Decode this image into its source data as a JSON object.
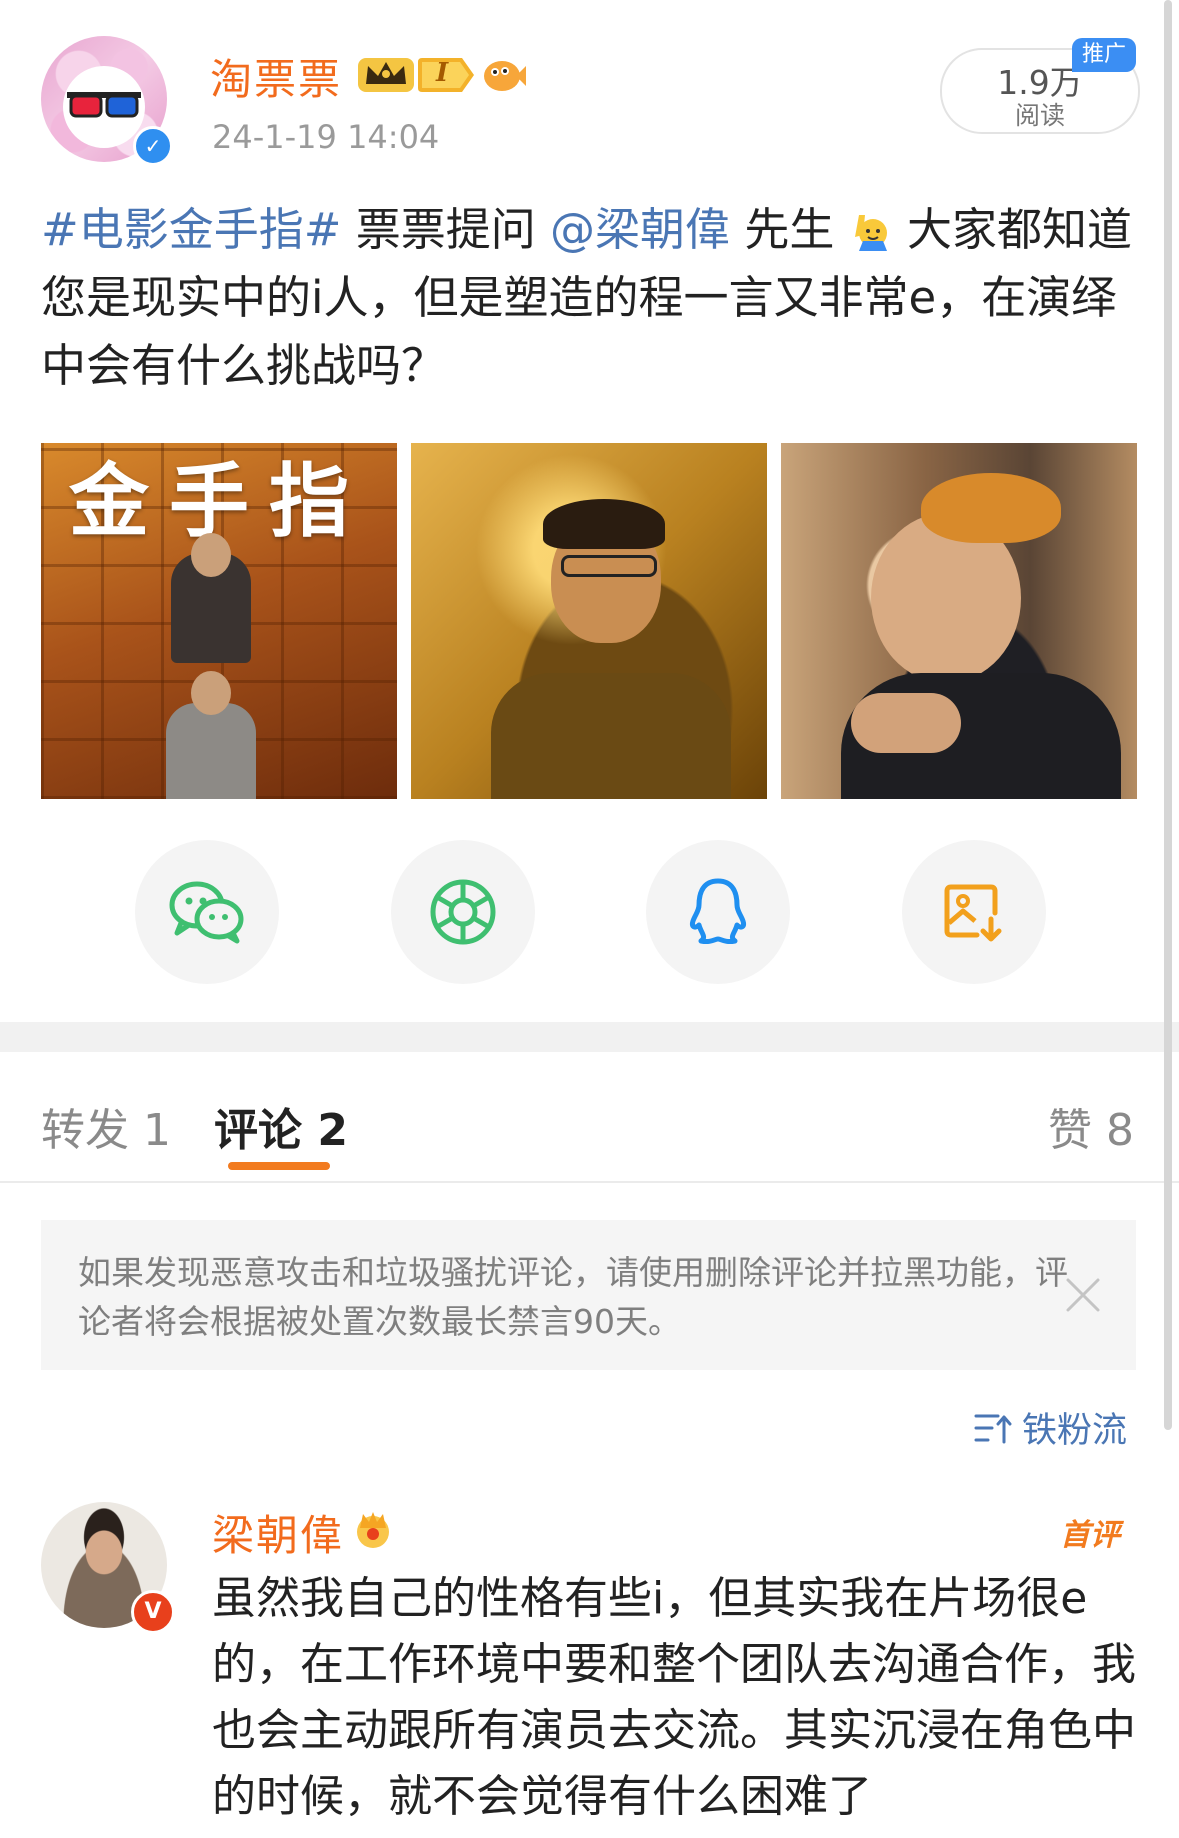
{
  "post": {
    "username": "淘票票",
    "level": "I",
    "timestamp": "24-1-19 14:04",
    "read_count": "1.9万",
    "read_label": "阅读",
    "promo_tag": "推广",
    "text_parts": {
      "hashtag": "#电影金手指#",
      "t1": " 票票提问 ",
      "mention": "@梁朝偉",
      "t2": " 先生 ",
      "t3": " 大家都知道您是现实中的i人，但是塑造的程一言又非常e，在演绎中会有什么挑战吗？"
    },
    "photos": [
      {
        "name": "poster-golden-finger",
        "overlay_text": "金手指"
      },
      {
        "name": "still-golden-finger"
      },
      {
        "name": "photo-actor-headband"
      }
    ]
  },
  "share": {
    "buttons": [
      {
        "name": "wechat",
        "icon": "wechat-icon",
        "color": "#3fbf70"
      },
      {
        "name": "moments",
        "icon": "moments-icon",
        "color": "#3fbf70"
      },
      {
        "name": "qq",
        "icon": "qq-icon",
        "color": "#1f8ff0"
      },
      {
        "name": "save-image",
        "icon": "save-image-icon",
        "color": "#f2a01c"
      }
    ]
  },
  "tabs": {
    "repost": "转发 1",
    "comment": "评论 2",
    "likes": "赞 8"
  },
  "notice": {
    "text": "如果发现恶意攻击和垃圾骚扰评论，请使用删除评论并拉黑功能，评论者将会根据被处置次数最长禁言90天。"
  },
  "sort": {
    "label": "铁粉流"
  },
  "comment": {
    "username": "梁朝偉",
    "tag": "首评",
    "text": "虽然我自己的性格有些i，但其实我在片场很e的，在工作环境中要和整个团队去沟通合作，我也会主动跟所有演员去交流。其实沉浸在角色中的时候，就不会觉得有什么困难了"
  },
  "colors": {
    "accent_orange": "#f26b1d",
    "link_blue": "#4a76b4",
    "verify_blue": "#2f8ff0",
    "verify_red": "#e8401c"
  }
}
